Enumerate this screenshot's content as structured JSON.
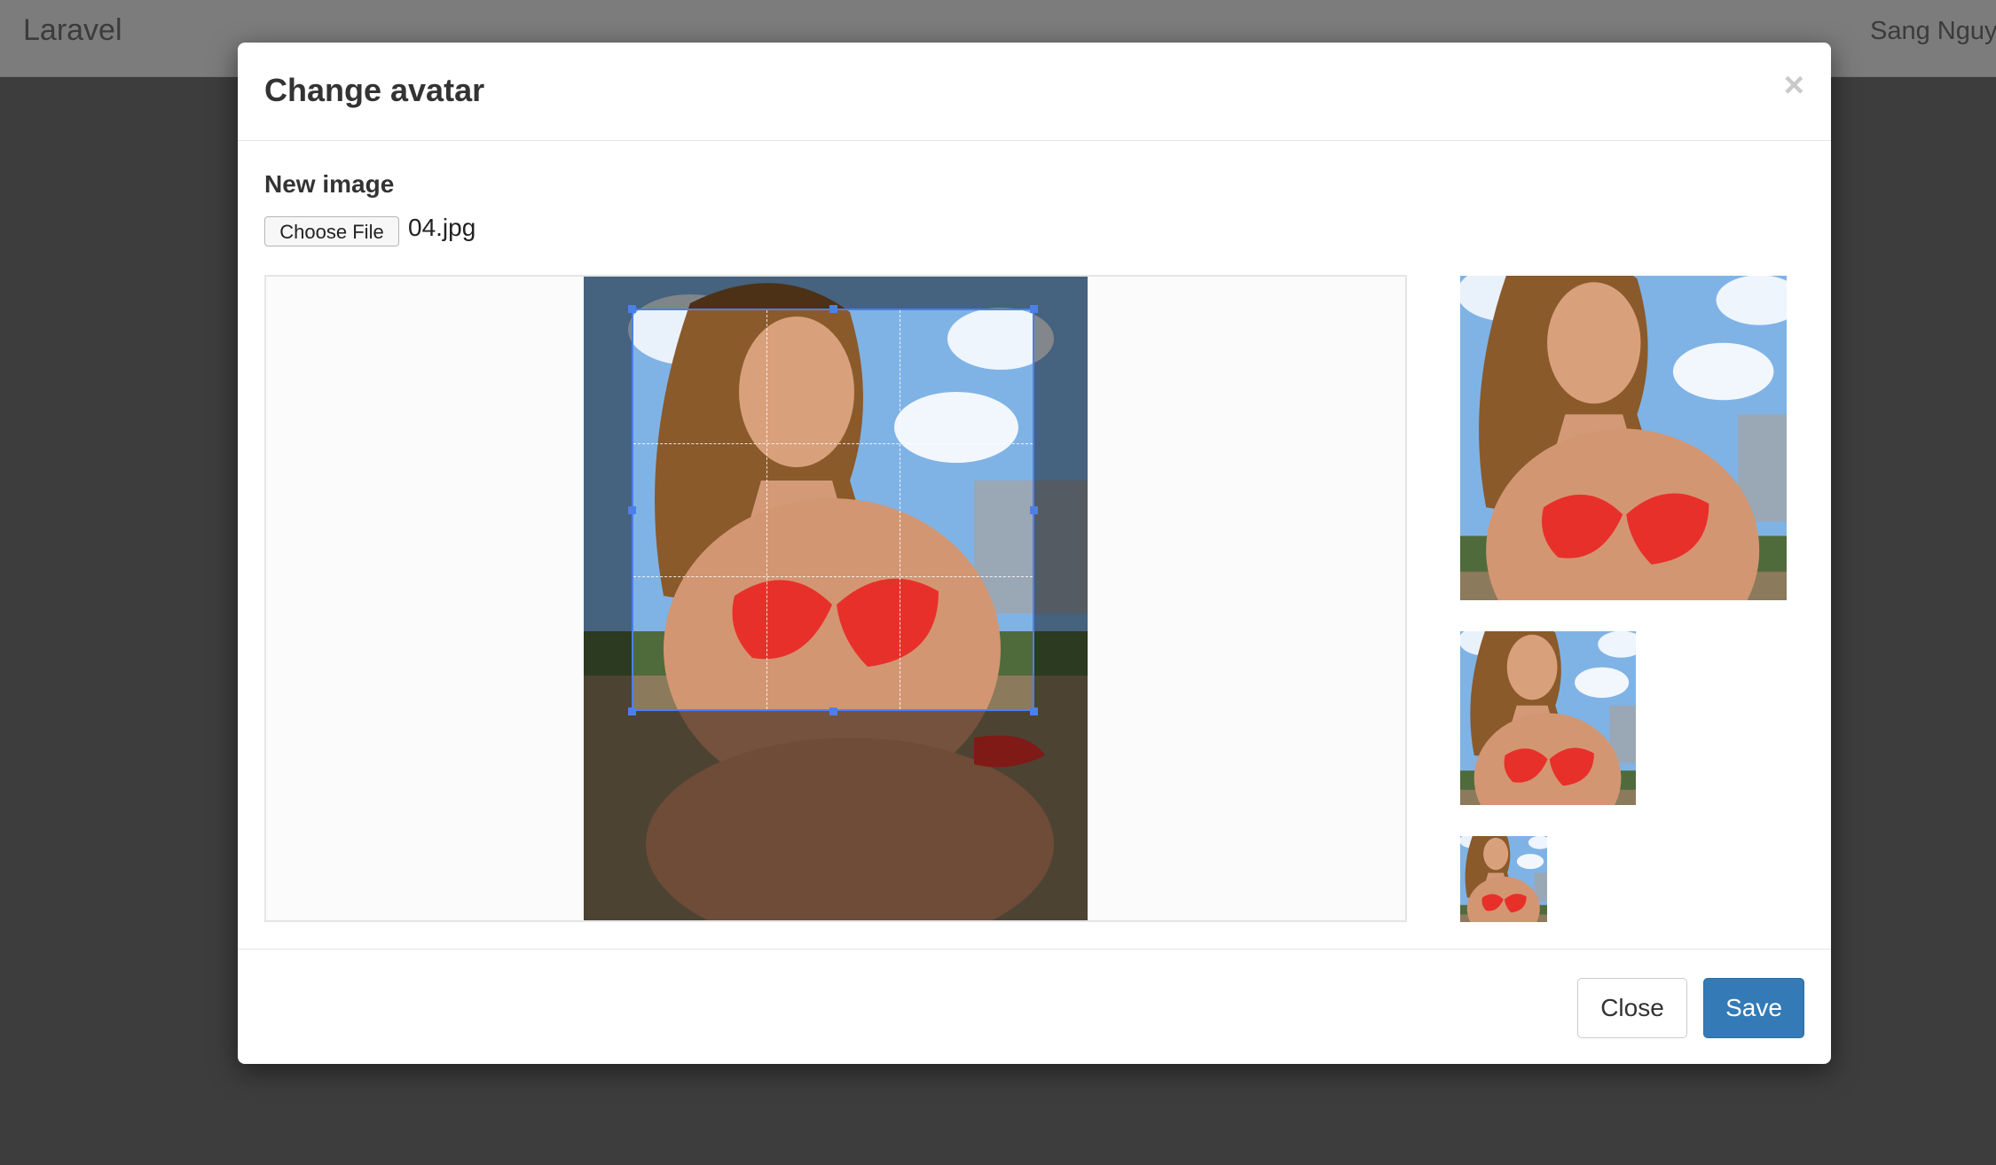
{
  "navbar": {
    "brand": "Laravel",
    "user": "Sang Nguye"
  },
  "modal": {
    "title": "Change avatar",
    "close_symbol": "×",
    "field_label": "New image",
    "file_button_label": "Choose File",
    "file_name": "04.jpg",
    "buttons": {
      "close": "Close",
      "save": "Save"
    },
    "image_description_icon": "photo-image",
    "colors": {
      "accent": "#337ab7",
      "crop_border": "#4d7fe8"
    }
  }
}
